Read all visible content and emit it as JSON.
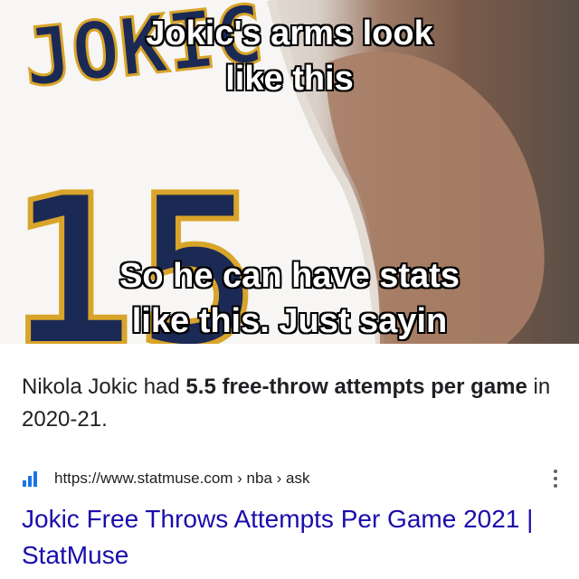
{
  "meme": {
    "jersey_name": "JOKIC",
    "jersey_number": "15",
    "caption_top": "Jokic's arms look\nlike this",
    "caption_bottom": "So he can have stats\nlike this. Just sayin"
  },
  "snippet": {
    "prefix": "Nikola Jokic had ",
    "bold": "5.5 free-throw attempts per game",
    "suffix": " in 2020-21."
  },
  "result": {
    "favicon": "statmuse-bars-icon",
    "url": "https://www.statmuse.com › nba › ask",
    "title": "Jokic Free Throws Attempts Per Game 2021 | StatMuse",
    "more_icon": "more-vert-icon"
  },
  "colors": {
    "link": "#1a0dab",
    "jersey_gold": "#d9a42a",
    "jersey_navy": "#1b2a55"
  }
}
